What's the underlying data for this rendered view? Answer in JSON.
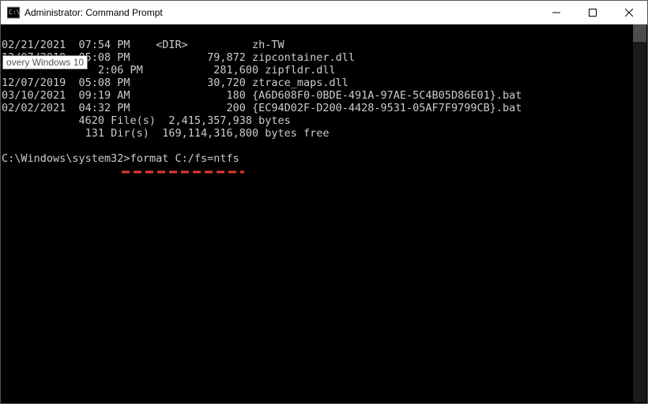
{
  "window": {
    "title": "Administrator: Command Prompt"
  },
  "tooltip": {
    "text": "overy Windows 10"
  },
  "lines": {
    "l0": "02/21/2021  07:54 PM    <DIR>          zh-TW",
    "l1": "12/07/2019  05:08 PM            79,872 zipcontainer.dll",
    "l2": "               2:06 PM           281,600 zipfldr.dll",
    "l3": "12/07/2019  05:08 PM            30,720 ztrace_maps.dll",
    "l4": "03/10/2021  09:19 AM               180 {A6D608F0-0BDE-491A-97AE-5C4B05D86E01}.bat",
    "l5": "02/02/2021  04:32 PM               200 {EC94D02F-D200-4428-9531-05AF7F9799CB}.bat",
    "l6": "            4620 File(s)  2,415,357,938 bytes",
    "l7": "             131 Dir(s)  169,114,316,800 bytes free",
    "l8": "",
    "prompt_path": "C:\\Windows\\system32>",
    "command": "format C:/fs=ntfs"
  }
}
